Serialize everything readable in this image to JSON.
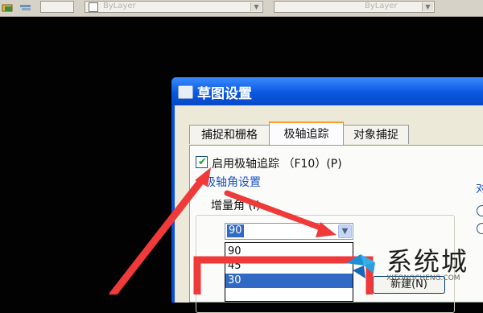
{
  "toolbar": {
    "bylayer_left": "ByLayer",
    "bylayer_right": "ByLayer"
  },
  "dialog": {
    "title": "草图设置",
    "tabs": [
      {
        "label": "捕捉和栅格"
      },
      {
        "label": "极轴追踪"
      },
      {
        "label": "对象捕捉"
      }
    ],
    "enable_polar": {
      "label": "启用极轴追踪 （F10）(P)",
      "checked": true
    },
    "polar_angle_group": {
      "title": "极轴角设置",
      "increment_label": "增量角 (I):",
      "increment_value": "90",
      "dropdown_options": [
        "90",
        "45",
        "30"
      ],
      "selected_option": "30",
      "new_button": "新建(N)"
    },
    "right_partial_label": "对"
  },
  "watermark": {
    "text": "系统城",
    "sub": "XITONGCHENG.COM"
  },
  "colors": {
    "annotation_red": "#f03a3a",
    "title_blue": "#0a57e0",
    "selection_blue": "#316ac5"
  }
}
